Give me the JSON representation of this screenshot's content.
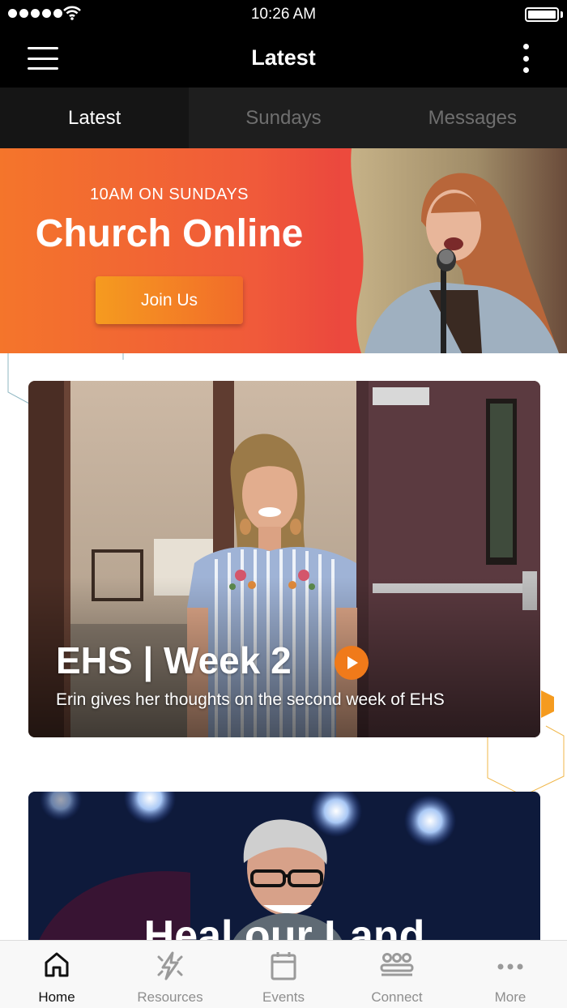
{
  "status_bar": {
    "time": "10:26 AM"
  },
  "header": {
    "title": "Latest"
  },
  "tabs": [
    {
      "label": "Latest",
      "active": true
    },
    {
      "label": "Sundays",
      "active": false
    },
    {
      "label": "Messages",
      "active": false
    }
  ],
  "banner": {
    "kicker": "10AM ON SUNDAYS",
    "headline": "Church Online",
    "button_label": "Join Us"
  },
  "cards": [
    {
      "title": "EHS | Week 2",
      "subtitle": "Erin gives her thoughts on the second week of EHS"
    },
    {
      "title": "Heal our Land"
    }
  ],
  "bottom_nav": [
    {
      "label": "Home",
      "icon": "home-icon",
      "active": true
    },
    {
      "label": "Resources",
      "icon": "lightning-icon",
      "active": false
    },
    {
      "label": "Events",
      "icon": "calendar-icon",
      "active": false
    },
    {
      "label": "Connect",
      "icon": "group-icon",
      "active": false
    },
    {
      "label": "More",
      "icon": "more-icon",
      "active": false
    }
  ],
  "colors": {
    "accent": "#f07a1a",
    "banner_start": "#f4752b",
    "banner_end": "#e6413f"
  }
}
